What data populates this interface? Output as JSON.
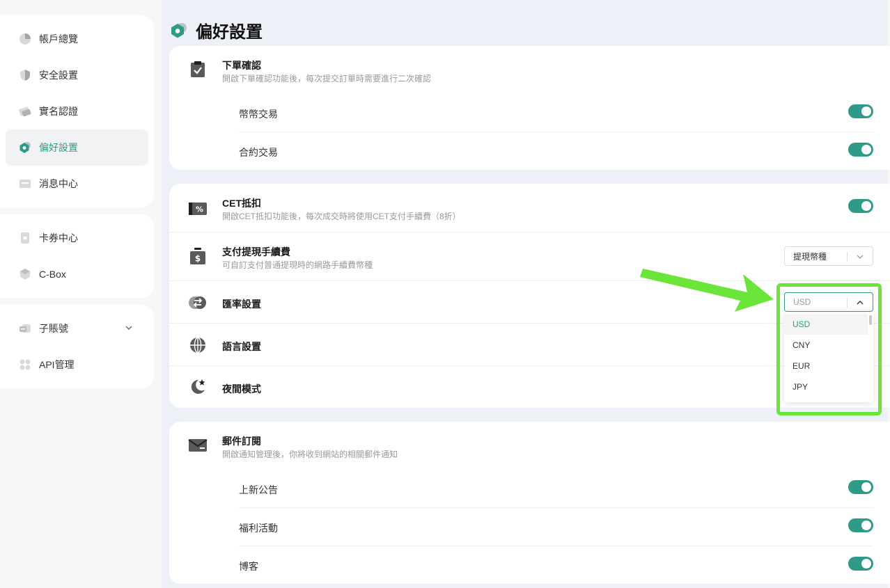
{
  "sidebar": {
    "group1": [
      {
        "label": "帳戶總覽",
        "icon": "pie-chart-icon",
        "active": false
      },
      {
        "label": "安全設置",
        "icon": "shield-icon",
        "active": false
      },
      {
        "label": "實名認證",
        "icon": "id-card-icon",
        "active": false
      },
      {
        "label": "偏好設置",
        "icon": "preferences-icon",
        "active": true
      },
      {
        "label": "消息中心",
        "icon": "message-icon",
        "active": false
      }
    ],
    "group2": [
      {
        "label": "卡券中心",
        "icon": "coupon-icon"
      },
      {
        "label": "C-Box",
        "icon": "box-icon"
      }
    ],
    "group3": [
      {
        "label": "子賬號",
        "icon": "sub-account-icon",
        "expandable": true
      },
      {
        "label": "API管理",
        "icon": "api-icon"
      }
    ]
  },
  "page": {
    "title": "偏好設置"
  },
  "order_confirm": {
    "title": "下單確認",
    "desc": "開啟下單確認功能後，每次提交訂單時需要進行二次確認",
    "items": [
      {
        "label": "幣幣交易",
        "on": true
      },
      {
        "label": "合約交易",
        "on": true
      }
    ]
  },
  "cet": {
    "title": "CET抵扣",
    "desc": "開啟CET抵扣功能後，每次成交時將使用CET支付手續費（8折）",
    "on": true
  },
  "withdraw_fee": {
    "title": "支付提現手續費",
    "desc": "可自訂支付普通提現時的網路手續費幣種",
    "select_value": "提現幣種"
  },
  "exchange_rate": {
    "title": "匯率設置",
    "select_value": "USD",
    "options": [
      "USD",
      "CNY",
      "EUR",
      "JPY"
    ],
    "selected": "USD"
  },
  "language": {
    "title": "語言設置"
  },
  "night_mode": {
    "title": "夜間模式"
  },
  "email": {
    "title": "郵件訂閱",
    "desc": "開啟通知管理後，你將收到網站的相關郵件通知",
    "items": [
      {
        "label": "上新公告",
        "on": true
      },
      {
        "label": "福利活動",
        "on": true
      },
      {
        "label": "博客",
        "on": true
      }
    ]
  },
  "colors": {
    "accent": "#2d9b88",
    "annotation": "#6be53a"
  }
}
